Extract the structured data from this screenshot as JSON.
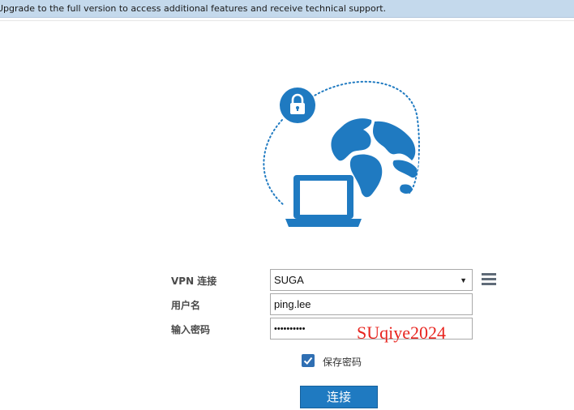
{
  "banner": {
    "text": "Upgrade to the full version to access additional features and receive technical support."
  },
  "colors": {
    "banner_bg": "#c4d9ec",
    "accent": "#1f7ac1",
    "watermark": "#e8251f"
  },
  "illustration": {
    "icons": [
      "lock-icon",
      "globe-icon",
      "laptop-icon"
    ]
  },
  "form": {
    "vpn_label": "VPN 连接",
    "vpn_value": "SUGA",
    "username_label": "用户名",
    "username_value": "ping.lee",
    "password_label": "输入密码",
    "password_value": "••••••••••",
    "remember_label": "保存密码",
    "remember_checked": true,
    "connect_label": "连接"
  },
  "watermark": {
    "text": "SUqiye2024"
  }
}
